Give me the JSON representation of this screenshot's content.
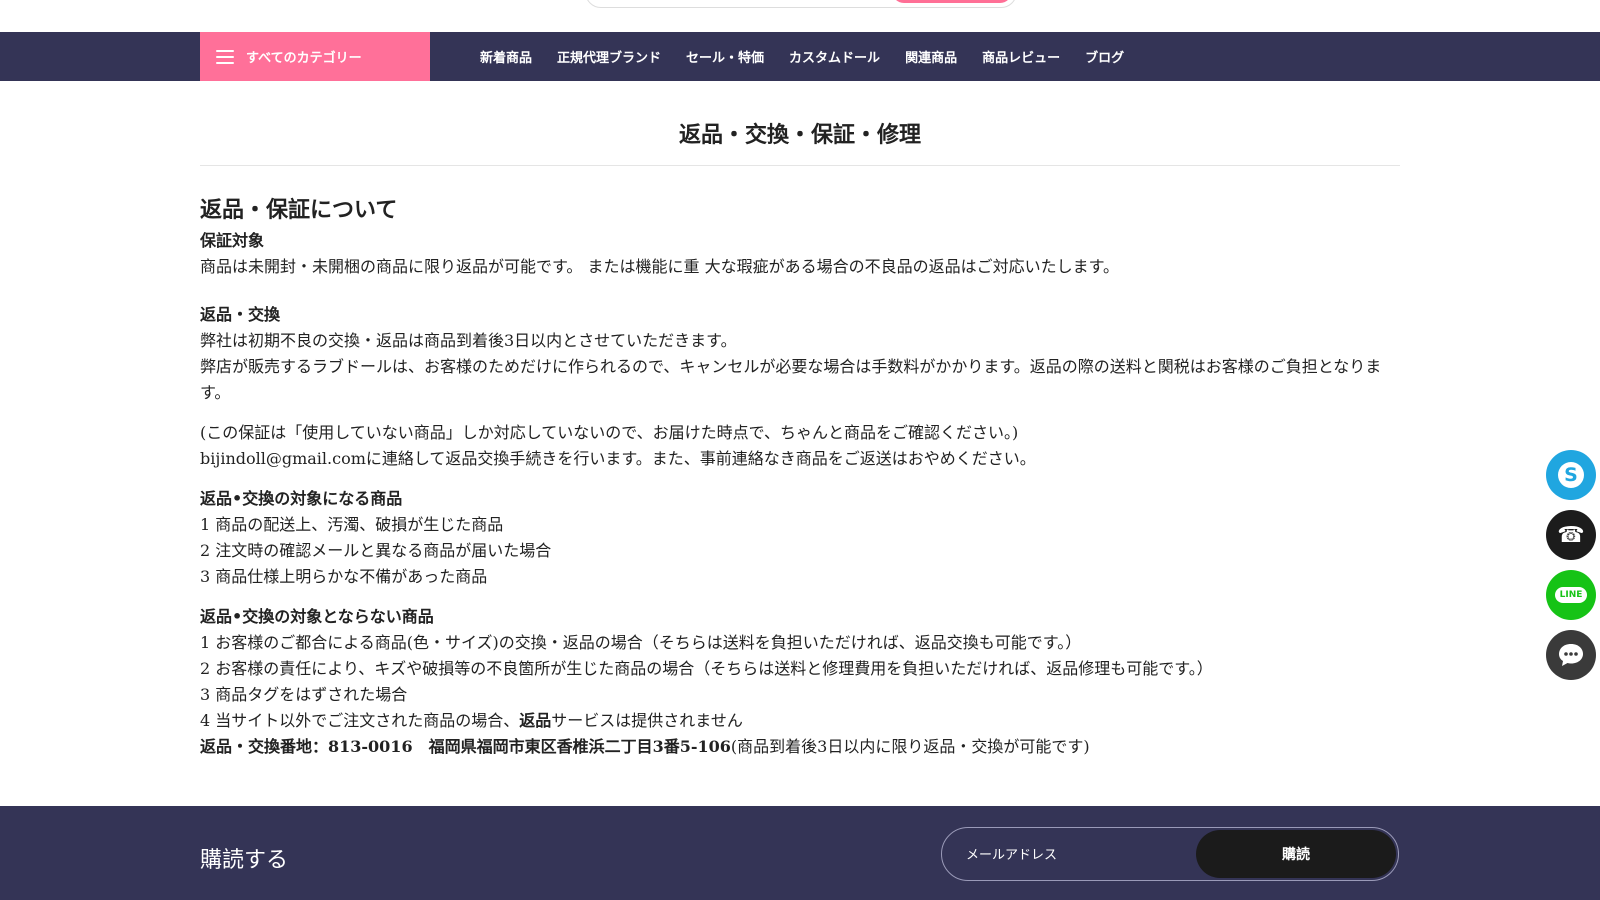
{
  "nav": {
    "category_label": "すべてのカテゴリー",
    "links": [
      "新着商品",
      "正規代理ブランド",
      "セール・特価",
      "カスタムドール",
      "関連商品",
      "商品レビュー",
      "ブログ"
    ]
  },
  "page": {
    "title": "返品・交換・保証・修理",
    "section_heading": "返品・保証について",
    "warranty_heading": "保証対象",
    "warranty_text": "商品は未開封・未開梱の商品に限り返品が可能です。 または機能に重 大な瑕疵がある場合の不良品の返品はご対応いたします。",
    "return_heading": "返品・交換",
    "return_line1": "弊社は初期不良の交換・返品は商品到着後3日以内とさせていただきます。",
    "return_line2": "弊店が販売するラブドールは、お客様のためだけに作られるので、キャンセルが必要な場合は手数料がかかります。返品の際の送料と関税はお客様のご負担となります。",
    "note_line1": "(この保証は「使用していない商品」しか対応していないので、お届けた時点で、ちゃんと商品をご確認ください。)",
    "note_line2": "bijindoll@gmail.comに連絡して返品交換手続きを行います。また、事前連絡なき商品をご返送はおやめください。",
    "eligible_heading": "返品•交換の対象になる商品",
    "eligible_items": [
      "1 商品の配送上、汚濁、破損が生じた商品",
      "2 注文時の確認メールと異なる商品が届いた場合",
      "3 商品仕様上明らかな不備があった商品"
    ],
    "ineligible_heading": "返品•交換の対象とならない商品",
    "ineligible_items": [
      "1 お客様のご都合による商品(色・サイズ)の交換・返品の場合（そちらは送料を負担いただければ、返品交換も可能です。）",
      "2 お客様の責任により、キズや破損等の不良箇所が生じた商品の場合（そちらは送料と修理費用を負担いただければ、返品修理も可能です。）",
      "3 商品タグをはずされた場合"
    ],
    "ineligible_item4_pre": "4 当サイト以外でご注文された商品の場合、",
    "ineligible_item4_bold": "返品",
    "ineligible_item4_post": "サービスは提供されません",
    "address_bold": "返品・交換番地：813-0016　福岡県福岡市東区香椎浜二丁目3番5-106",
    "address_tail": "(商品到着後3日以内に限り返品・交換が可能です)"
  },
  "footer": {
    "subscribe_title": "購読する",
    "email_placeholder": "メールアドレス",
    "subscribe_button": "購読"
  },
  "float_buttons": {
    "line_label": "LINE"
  },
  "icons": [
    "menu-icon",
    "skype-icon",
    "phone-icon",
    "line-icon",
    "chat-icon"
  ],
  "colors": {
    "nav_bg": "#343456",
    "accent_pink": "#ff7099",
    "skype": "#20a6e0",
    "line": "#16c316"
  }
}
